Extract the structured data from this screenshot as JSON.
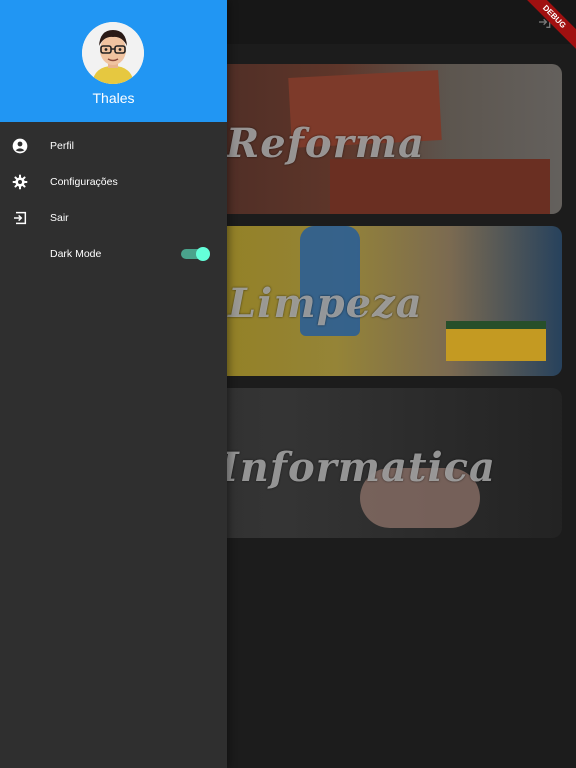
{
  "appbar": {
    "debug_label": "DEBUG",
    "logout_icon": "logout-icon"
  },
  "categories": [
    {
      "label": "Reforma"
    },
    {
      "label": "Limpeza"
    },
    {
      "label": "Informatica"
    }
  ],
  "drawer": {
    "header_color": "#2196f3",
    "user_name": "Thales",
    "avatar_icon": "avatar",
    "items": [
      {
        "icon": "account-circle-icon",
        "label": "Perfil"
      },
      {
        "icon": "settings-icon",
        "label": "Configurações"
      },
      {
        "icon": "login-icon",
        "label": "Sair"
      },
      {
        "icon": "moon-icon",
        "label": "Dark Mode"
      }
    ],
    "dark_mode": {
      "enabled": true,
      "accent": "#64ffda"
    }
  }
}
